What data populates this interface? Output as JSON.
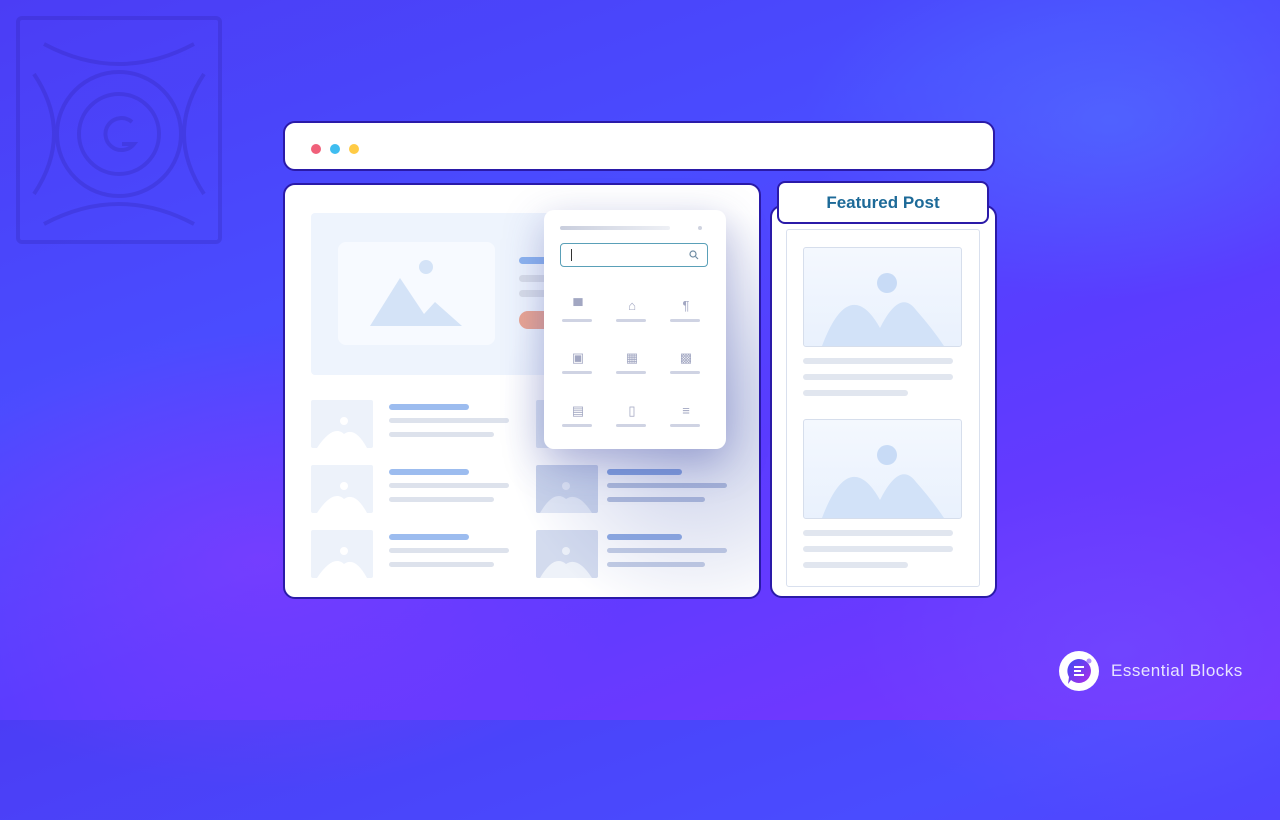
{
  "background": {
    "decoration": "wordpress-gutenberg-pattern-icon"
  },
  "browser": {
    "window_controls": [
      {
        "name": "close",
        "color": "#f0607a"
      },
      {
        "name": "minimize",
        "color": "#3fbdf0"
      },
      {
        "name": "maximize",
        "color": "#ffcb45"
      }
    ]
  },
  "block_inserter": {
    "search_placeholder": "",
    "blocks": [
      {
        "icon": "bookmark-icon",
        "glyph": "▀"
      },
      {
        "icon": "home-icon",
        "glyph": "⌂"
      },
      {
        "icon": "paragraph-icon",
        "glyph": "¶"
      },
      {
        "icon": "image-icon",
        "glyph": "▣"
      },
      {
        "icon": "columns-icon",
        "glyph": "▦"
      },
      {
        "icon": "gallery-icon",
        "glyph": "▩"
      },
      {
        "icon": "comments-icon",
        "glyph": "▤"
      },
      {
        "icon": "calendar-icon",
        "glyph": "▯"
      },
      {
        "icon": "align-left-icon",
        "glyph": "≡"
      }
    ]
  },
  "featured_post": {
    "label": "Featured Post"
  },
  "brand": {
    "name": "Essential Blocks",
    "accent": "#6d2ff0"
  }
}
